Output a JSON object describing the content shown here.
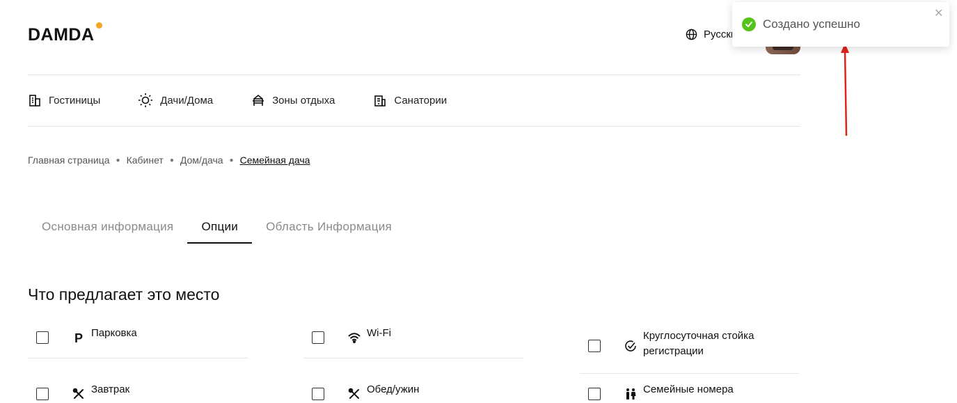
{
  "header": {
    "logo": "DAMDA",
    "language": "Русский",
    "language_icon": "globe-icon"
  },
  "categories": [
    {
      "label": "Гостиницы",
      "icon": "hotel-icon"
    },
    {
      "label": "Дачи/Дома",
      "icon": "sun-icon"
    },
    {
      "label": "Зоны отдыха",
      "icon": "recreation-icon"
    },
    {
      "label": "Санатории",
      "icon": "sanatorium-icon"
    }
  ],
  "breadcrumb": {
    "items": [
      "Главная страница",
      "Кабинет",
      "Дом/дача"
    ],
    "current": "Семейная дача"
  },
  "tabs": {
    "items": [
      "Основная информация",
      "Опции",
      "Область Информация"
    ],
    "active": "Опции"
  },
  "section": {
    "title": "Что предлагает это место"
  },
  "options": [
    {
      "label": "Парковка",
      "icon": "parking-icon",
      "checked": false
    },
    {
      "label": "Wi-Fi",
      "icon": "wifi-icon",
      "checked": false
    },
    {
      "label": "Круглосуточная стойка регистрации",
      "icon": "check-circle-icon",
      "checked": false
    },
    {
      "label": "Завтрак",
      "icon": "cutlery-icon",
      "checked": false
    },
    {
      "label": "Обед/ужин",
      "icon": "cutlery-icon",
      "checked": false
    },
    {
      "label": "Семейные номера",
      "icon": "family-icon",
      "checked": false
    }
  ],
  "toast": {
    "message": "Создано успешно",
    "status": "success",
    "color": "#52c41a"
  },
  "colors": {
    "accent_dot": "#f5a623",
    "annotation_arrow": "#e0241b"
  }
}
